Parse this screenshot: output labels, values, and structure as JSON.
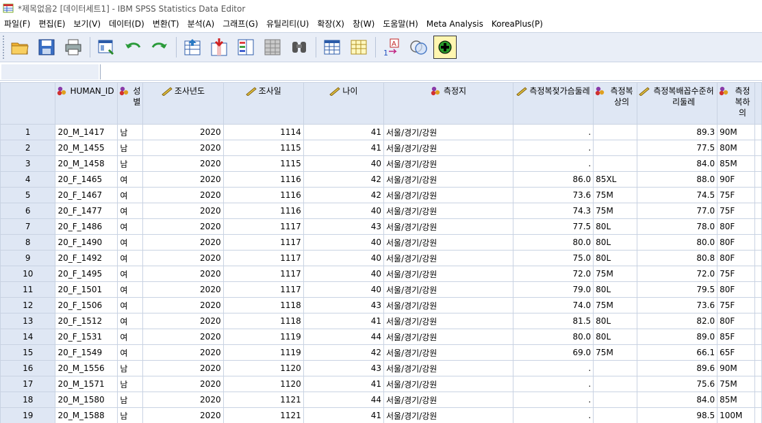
{
  "window": {
    "title": "*제목없음2 [데이터세트1] - IBM SPSS Statistics Data Editor"
  },
  "menu": [
    "파일(F)",
    "편집(E)",
    "보기(V)",
    "데이터(D)",
    "변환(T)",
    "분석(A)",
    "그래프(G)",
    "유틸리티(U)",
    "확장(X)",
    "창(W)",
    "도움말(H)",
    "Meta Analysis",
    "KoreaPlus(P)"
  ],
  "toolbar": {
    "icons": [
      "open-folder-icon",
      "save-icon",
      "print-icon",
      "dialog-recall-icon",
      "undo-icon",
      "redo-icon",
      "goto-case-icon",
      "goto-variable-icon",
      "variables-icon",
      "run-descriptives-icon",
      "find-icon",
      "split-file-icon",
      "select-cases-icon",
      "value-labels-icon",
      "weight-cases-icon",
      "spell-check-icon",
      "use-sets-icon"
    ]
  },
  "cell_editor": {
    "name": "",
    "value": ""
  },
  "columns": [
    {
      "label": "HUMAN_ID",
      "type": "nominal"
    },
    {
      "label": "성별",
      "type": "nominal"
    },
    {
      "label": "조사년도",
      "type": "scale"
    },
    {
      "label": "조사일",
      "type": "scale"
    },
    {
      "label": "나이",
      "type": "scale"
    },
    {
      "label": "측정지",
      "type": "nominal"
    },
    {
      "label": "측정복젖가슴둘레",
      "type": "scale"
    },
    {
      "label": "측정복상의",
      "type": "nominal"
    },
    {
      "label": "측정복배꼽수준허리둘레",
      "type": "scale"
    },
    {
      "label": "측정복하의",
      "type": "nominal"
    }
  ],
  "rows": [
    [
      "1",
      "20_M_1417",
      "남",
      "2020",
      "1114",
      "41",
      "서울/경기/강원",
      ".",
      "",
      "89.3",
      "90M"
    ],
    [
      "2",
      "20_M_1455",
      "남",
      "2020",
      "1115",
      "41",
      "서울/경기/강원",
      ".",
      "",
      "77.5",
      "80M"
    ],
    [
      "3",
      "20_M_1458",
      "남",
      "2020",
      "1115",
      "40",
      "서울/경기/강원",
      ".",
      "",
      "84.0",
      "85M"
    ],
    [
      "4",
      "20_F_1465",
      "여",
      "2020",
      "1116",
      "42",
      "서울/경기/강원",
      "86.0",
      "85XL",
      "88.0",
      "90F"
    ],
    [
      "5",
      "20_F_1467",
      "여",
      "2020",
      "1116",
      "42",
      "서울/경기/강원",
      "73.6",
      "75M",
      "74.5",
      "75F"
    ],
    [
      "6",
      "20_F_1477",
      "여",
      "2020",
      "1116",
      "40",
      "서울/경기/강원",
      "74.3",
      "75M",
      "77.0",
      "75F"
    ],
    [
      "7",
      "20_F_1486",
      "여",
      "2020",
      "1117",
      "43",
      "서울/경기/강원",
      "77.5",
      "80L",
      "78.0",
      "80F"
    ],
    [
      "8",
      "20_F_1490",
      "여",
      "2020",
      "1117",
      "40",
      "서울/경기/강원",
      "80.0",
      "80L",
      "80.0",
      "80F"
    ],
    [
      "9",
      "20_F_1492",
      "여",
      "2020",
      "1117",
      "40",
      "서울/경기/강원",
      "75.0",
      "80L",
      "80.8",
      "80F"
    ],
    [
      "10",
      "20_F_1495",
      "여",
      "2020",
      "1117",
      "40",
      "서울/경기/강원",
      "72.0",
      "75M",
      "72.0",
      "75F"
    ],
    [
      "11",
      "20_F_1501",
      "여",
      "2020",
      "1117",
      "40",
      "서울/경기/강원",
      "79.0",
      "80L",
      "79.5",
      "80F"
    ],
    [
      "12",
      "20_F_1506",
      "여",
      "2020",
      "1118",
      "43",
      "서울/경기/강원",
      "74.0",
      "75M",
      "73.6",
      "75F"
    ],
    [
      "13",
      "20_F_1512",
      "여",
      "2020",
      "1118",
      "41",
      "서울/경기/강원",
      "81.5",
      "80L",
      "82.0",
      "80F"
    ],
    [
      "14",
      "20_F_1531",
      "여",
      "2020",
      "1119",
      "44",
      "서울/경기/강원",
      "80.0",
      "80L",
      "89.0",
      "85F"
    ],
    [
      "15",
      "20_F_1549",
      "여",
      "2020",
      "1119",
      "42",
      "서울/경기/강원",
      "69.0",
      "75M",
      "66.1",
      "65F"
    ],
    [
      "16",
      "20_M_1556",
      "남",
      "2020",
      "1120",
      "43",
      "서울/경기/강원",
      ".",
      "",
      "89.6",
      "90M"
    ],
    [
      "17",
      "20_M_1571",
      "남",
      "2020",
      "1120",
      "41",
      "서울/경기/강원",
      ".",
      "",
      "75.6",
      "75M"
    ],
    [
      "18",
      "20_M_1580",
      "남",
      "2020",
      "1121",
      "44",
      "서울/경기/강원",
      ".",
      "",
      "84.0",
      "85M"
    ],
    [
      "19",
      "20_M_1588",
      "남",
      "2020",
      "1121",
      "41",
      "서울/경기/강원",
      ".",
      "",
      "98.5",
      "100M"
    ]
  ],
  "colors": {
    "header_bg": "#dfe7f4",
    "toolbar_bg": "#e9eef7",
    "grid_line": "#c8d2e2"
  }
}
